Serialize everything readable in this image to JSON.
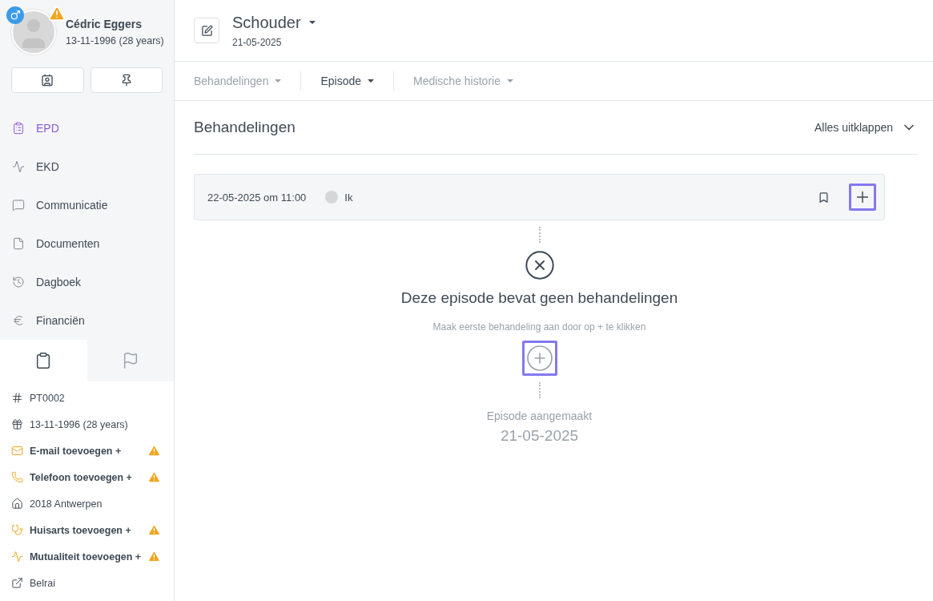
{
  "patient": {
    "name": "Cédric Eggers",
    "birth": "13-11-1996 (28 years)",
    "warning": true
  },
  "nav": [
    {
      "label": "EPD",
      "selected": true
    },
    {
      "label": "EKD",
      "selected": false
    },
    {
      "label": "Communicatie",
      "selected": false
    },
    {
      "label": "Documenten",
      "selected": false
    },
    {
      "label": "Dagboek",
      "selected": false
    },
    {
      "label": "Financiën",
      "selected": false
    }
  ],
  "panel_tabs": [
    {
      "selected": true
    },
    {
      "selected": false
    }
  ],
  "info": [
    {
      "text": "PT0002",
      "kind": "info",
      "warning": false
    },
    {
      "text": "13-11-1996 (28 years)",
      "kind": "info",
      "warning": false
    },
    {
      "text": "E-mail toevoegen +",
      "kind": "add",
      "warning": true
    },
    {
      "text": "Telefoon toevoegen +",
      "kind": "add",
      "warning": true
    },
    {
      "text": "2018 Antwerpen",
      "kind": "info",
      "warning": false
    },
    {
      "text": "Huisarts toevoegen +",
      "kind": "add",
      "warning": true
    },
    {
      "text": "Mutualiteit toevoegen +",
      "kind": "add",
      "warning": true
    },
    {
      "text": "Belrai",
      "kind": "info",
      "warning": false
    }
  ],
  "episode": {
    "title": "Schouder",
    "date": "21-05-2025"
  },
  "tabs": [
    {
      "label": "Behandelingen",
      "selected": false
    },
    {
      "label": "Episode",
      "selected": true
    },
    {
      "label": "Medische historie",
      "selected": false
    }
  ],
  "section": {
    "title": "Behandelingen",
    "expand": "Alles uitklappen"
  },
  "treatment": {
    "datetime": "22-05-2025 om 11:00",
    "user": "Ik"
  },
  "empty": {
    "title": "Deze episode bevat geen behandelingen",
    "hint": "Maak eerste behandeling aan door op + te klikken"
  },
  "created": {
    "label": "Episode aangemaakt",
    "date": "21-05-2025"
  }
}
